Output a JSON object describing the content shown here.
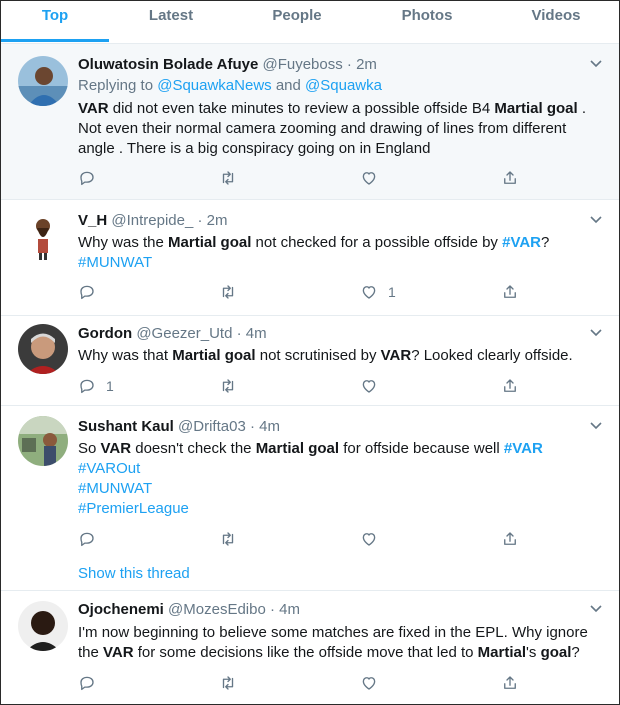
{
  "tabs": [
    "Top",
    "Latest",
    "People",
    "Photos",
    "Videos"
  ],
  "tweets": [
    {
      "name": "Oluwatosin Bolade Afuye",
      "handle": "@Fuyeboss",
      "dot": "·",
      "time": "2m",
      "reply_prefix": "Replying to ",
      "reply_to_1": "@SquawkaNews",
      "reply_and": " and ",
      "reply_to_2": "@Squawka",
      "t1": "VAR",
      "t2": " did not even take minutes to review a possible offside B4 ",
      "t3": "Martial goal",
      "t4": " . Not even their normal camera zooming and drawing of lines from different angle . There is a big conspiracy going on in England",
      "like_count": ""
    },
    {
      "name": "V_H",
      "handle": "@Intrepide_",
      "dot": "·",
      "time": "2m",
      "t1": "Why was the ",
      "t2": "Martial goal",
      "t3": " not checked for a possible offside by ",
      "t4": "#VAR",
      "t5": "?",
      "t6": "#MUNWAT",
      "like_count": "1"
    },
    {
      "name": "Gordon",
      "handle": "@Geezer_Utd",
      "dot": "·",
      "time": "4m",
      "t1": "Why was that ",
      "t2": "Martial goal",
      "t3": " not scrutinised by ",
      "t4": "VAR",
      "t5": "? Looked clearly offside.",
      "reply_count": "1"
    },
    {
      "name": "Sushant Kaul",
      "handle": "@Drifta03",
      "dot": "·",
      "time": "4m",
      "t1": "So ",
      "t2": "VAR",
      "t3": " doesn't check the ",
      "t4": "Martial goal",
      "t5": " for offside because well ",
      "t6": "#VAR",
      "tag1": "#VAROut",
      "tag2": "#MUNWAT",
      "tag3": "#PremierLeague",
      "show_thread": "Show this thread"
    },
    {
      "name": "Ojochenemi",
      "handle": "@MozesEdibo",
      "dot": "·",
      "time": "4m",
      "t1": "I'm now beginning to believe some matches are fixed in the EPL. Why ignore the ",
      "t2": "VAR",
      "t3": " for some decisions like the offside move that led to ",
      "t4": "Martial",
      "t5": "'s ",
      "t6": "goal",
      "t7": "?"
    }
  ],
  "icons": {
    "reply": "reply-icon",
    "retweet": "retweet-icon",
    "like": "heart-icon",
    "share": "share-icon",
    "caret": "chevron-down-icon"
  },
  "colors": {
    "accent": "#1da1f2",
    "muted": "#657786",
    "highlight_bg": "#f5f8fa"
  }
}
